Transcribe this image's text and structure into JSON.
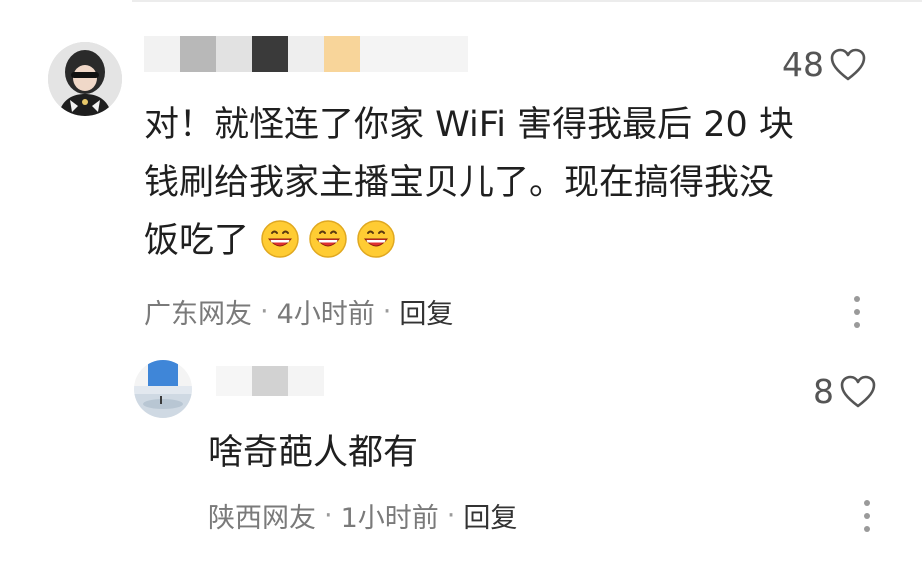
{
  "comment": {
    "username_masked": true,
    "mosaic_colors": [
      "#f2f2f2",
      "#b8b8b8",
      "#e2e2e2",
      "#3a3a3a",
      "#eeeeee",
      "#f8d59a",
      "#f4f4f4"
    ],
    "likes": "48",
    "text_line1": "对！就怪连了你家 WiFi 害得我最后 20 块",
    "text_line2": "钱刷给我家主播宝贝儿了。现在搞得我没",
    "text_line3": "饭吃了",
    "emoji_count": 3,
    "location": "广东网友",
    "separator": "·",
    "time": "4小时前",
    "reply_label": "回复",
    "icons": [
      "heart-outline-icon",
      "more-vertical-icon",
      "grinning-emoji-icon"
    ]
  },
  "reply": {
    "username_masked": true,
    "mosaic_colors": [
      "#f6f6f6",
      "#d2d2d2",
      "#f4f4f4"
    ],
    "likes": "8",
    "text": "啥奇葩人都有",
    "location": "陕西网友",
    "separator": "·",
    "time": "1小时前",
    "reply_label": "回复",
    "icons": [
      "heart-outline-icon",
      "more-vertical-icon"
    ]
  },
  "colors": {
    "text": "#1f1f1f",
    "meta": "#7a7a7a",
    "emoji_face": "#ffcc33",
    "emoji_mouth": "#e03030",
    "avatar_sky": "#3f86d8"
  }
}
